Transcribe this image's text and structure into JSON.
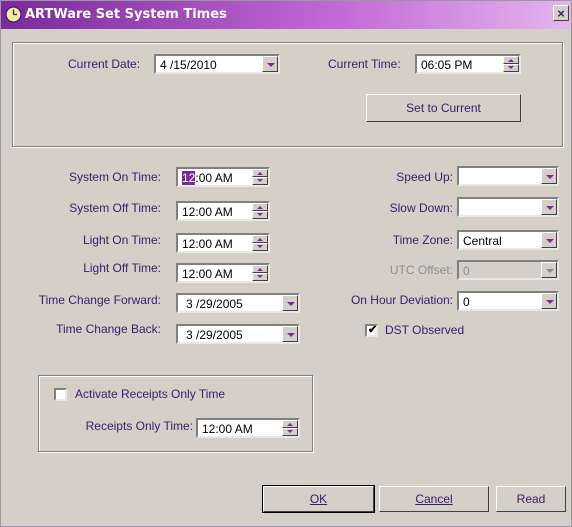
{
  "window": {
    "title": "ARTWare Set System Times",
    "close_glyph": "×"
  },
  "top": {
    "current_date_label": "Current Date:",
    "current_date_value": "4 /15/2010",
    "current_time_label": "Current Time:",
    "current_time_value": "06:05 PM",
    "set_current_label": "Set to Current"
  },
  "left": {
    "system_on_label": "System On Time:",
    "system_on_hl": "12",
    "system_on_rest": ":00 AM",
    "system_off_label": "System Off Time:",
    "system_off_value": "12:00 AM",
    "light_on_label": "Light On Time:",
    "light_on_value": "12:00 AM",
    "light_off_label": "Light Off Time:",
    "light_off_value": "12:00 AM",
    "tc_forward_label": "Time Change Forward:",
    "tc_forward_value": "3 /29/2005",
    "tc_back_label": "Time Change Back:",
    "tc_back_value": "3 /29/2005"
  },
  "right": {
    "speed_up_label": "Speed Up:",
    "speed_up_value": "",
    "slow_down_label": "Slow Down:",
    "slow_down_value": "",
    "time_zone_label": "Time Zone:",
    "time_zone_value": "Central",
    "utc_offset_label": "UTC Offset:",
    "utc_offset_value": "0",
    "on_hour_label": "On Hour Deviation:",
    "on_hour_value": "0",
    "dst_label": "DST Observed",
    "dst_checked": true
  },
  "receipts": {
    "activate_label": "Activate Receipts Only Time",
    "activate_checked": false,
    "time_label": "Receipts Only Time:",
    "time_value": "12:00 AM"
  },
  "footer": {
    "ok_label": "OK",
    "cancel_label": "Cancel",
    "read_label": "Read"
  },
  "colors": {
    "title_start": "#7a2a9c",
    "label_text": "#3a1a6e",
    "face": "#d4d0c8"
  },
  "icons": {
    "title": "clock-icon",
    "check": "checkmark-icon"
  }
}
